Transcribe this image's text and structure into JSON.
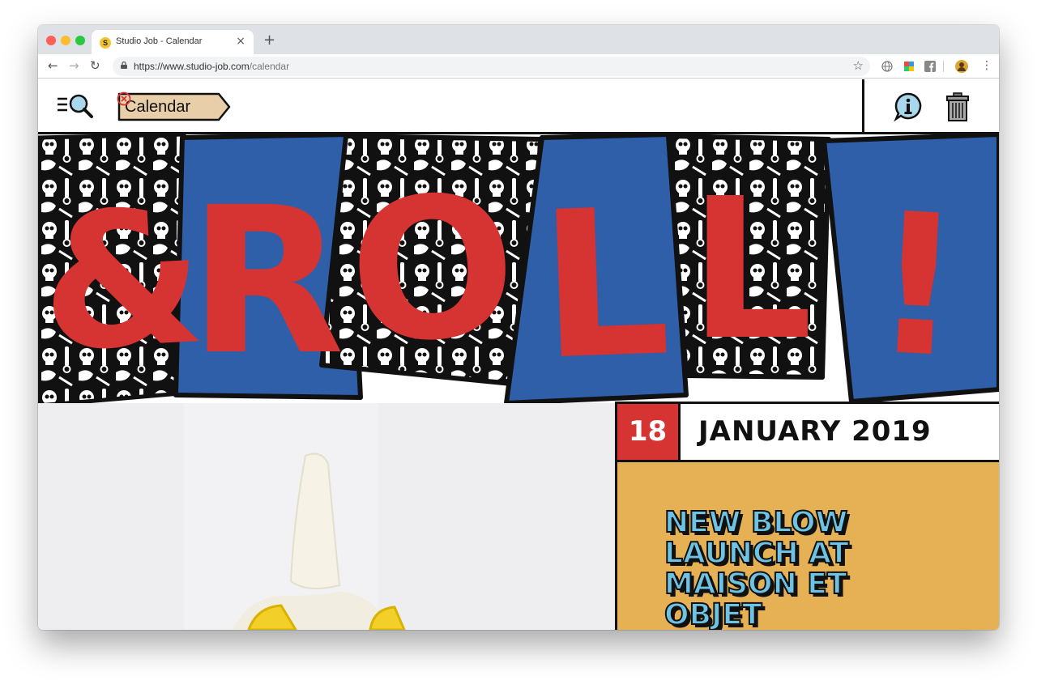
{
  "browser": {
    "tab_title": "Studio Job - Calendar",
    "favicon_letter": "S",
    "tab_close": "×",
    "new_tab": "+",
    "url_host": "https://www.studio-job.com",
    "url_path": "/calendar",
    "back": "←",
    "forward": "→",
    "reload": "↻",
    "bookmark_star": "☆"
  },
  "header": {
    "filter_chip_label": "Calendar"
  },
  "banner": {
    "letters": [
      "&",
      "R",
      "O",
      "L",
      "L",
      "!"
    ],
    "colors": {
      "red": "#d63333",
      "blue": "#2f5fa8",
      "black": "#111111"
    }
  },
  "event": {
    "day": "18",
    "month_year": "JANUARY 2019",
    "title": "NEW BLOW LAUNCH AT MAISON ET OBJET",
    "card_color": "#e6b055",
    "title_color": "#6ec3e4"
  }
}
